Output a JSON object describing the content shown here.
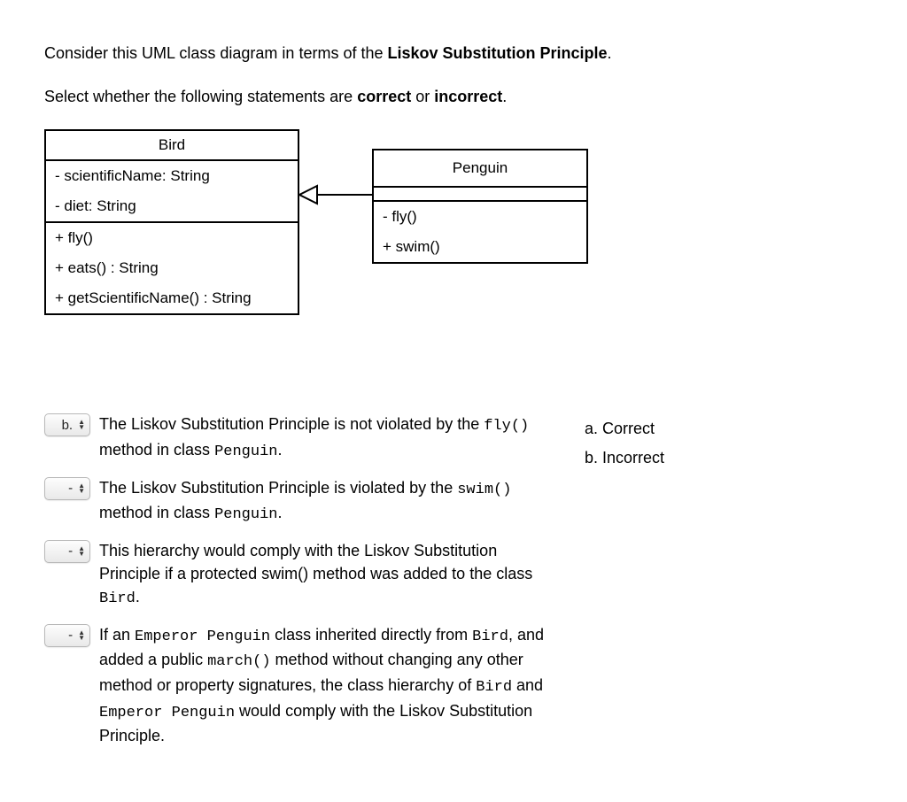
{
  "intro": {
    "line1_pre": "Consider this UML class diagram in terms of the ",
    "line1_bold": "Liskov Substitution Principle",
    "line1_post": ".",
    "line2_pre": "Select whether the following statements are ",
    "line2_b1": "correct",
    "line2_mid": " or ",
    "line2_b2": "incorrect",
    "line2_post": "."
  },
  "uml": {
    "bird": {
      "title": "Bird",
      "attrs": [
        "- scientificName: String",
        "- diet: String"
      ],
      "methods": [
        "+ fly()",
        "+ eats() : String",
        "+ getScientificName() : String"
      ]
    },
    "penguin": {
      "title": "Penguin",
      "methods": [
        "- fly()",
        "+ swim()"
      ]
    }
  },
  "questions": [
    {
      "select": "b.",
      "parts": [
        {
          "t": "The Liskov Substitution Principle is not violated by the "
        },
        {
          "t": "fly()",
          "mono": true
        },
        {
          "t": " method in class "
        },
        {
          "t": "Penguin",
          "mono": true
        },
        {
          "t": "."
        }
      ]
    },
    {
      "select": "-",
      "parts": [
        {
          "t": "The Liskov Substitution Principle is violated by the "
        },
        {
          "t": "swim()",
          "mono": true
        },
        {
          "t": " method in class "
        },
        {
          "t": "Penguin",
          "mono": true
        },
        {
          "t": "."
        }
      ]
    },
    {
      "select": "-",
      "parts": [
        {
          "t": "This hierarchy would comply with the Liskov Substitution Principle if a protected swim() method was added to the class "
        },
        {
          "t": "Bird",
          "mono": true
        },
        {
          "t": "."
        }
      ]
    },
    {
      "select": "-",
      "parts": [
        {
          "t": "If an "
        },
        {
          "t": "Emperor Penguin",
          "mono": true
        },
        {
          "t": " class inherited directly from "
        },
        {
          "t": "Bird",
          "mono": true
        },
        {
          "t": ", and added a public "
        },
        {
          "t": "march()",
          "mono": true
        },
        {
          "t": " method without changing any other method or property signatures, the class hierarchy of "
        },
        {
          "t": "Bird",
          "mono": true
        },
        {
          "t": " and "
        },
        {
          "t": "Emperor Penguin",
          "mono": true
        },
        {
          "t": " would comply with the Liskov Substitution Principle."
        }
      ]
    }
  ],
  "answers": {
    "a": "a. Correct",
    "b": "b. Incorrect"
  }
}
